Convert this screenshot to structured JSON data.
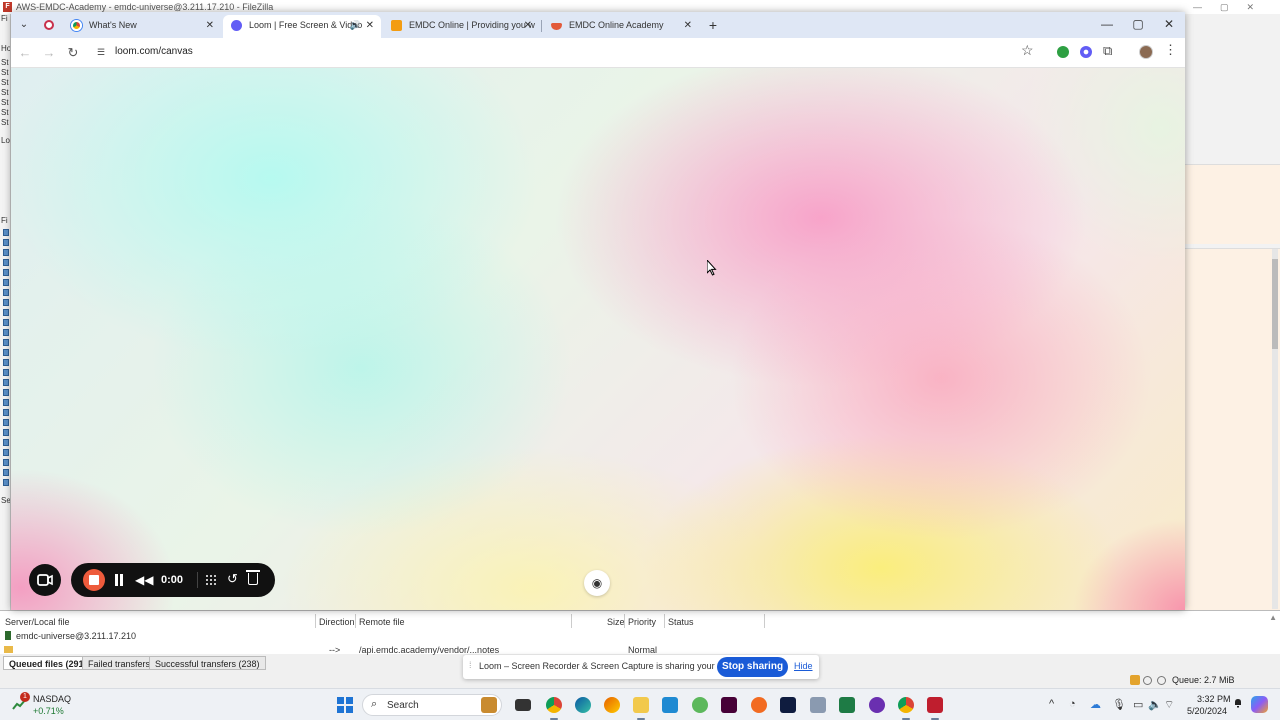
{
  "filezilla": {
    "title": "AWS-EMDC-Academy - emdc-universe@3.211.17.210 - FileZilla",
    "left_strip_lines": [
      "Fi",
      "Ho",
      "St",
      "St",
      "St",
      "St",
      "St",
      "St",
      "St",
      "Lo",
      "Fi",
      "Se"
    ],
    "queue": {
      "headers": {
        "server_local_file": "Server/Local file",
        "direction": "Direction",
        "remote_file": "Remote file",
        "size": "Size",
        "priority": "Priority",
        "status": "Status"
      },
      "server": "emdc-universe@3.211.17.210",
      "row": {
        "direction": "-->",
        "remote_file": "/api.emdc.academy/vendor/...notes",
        "priority": "Normal"
      }
    },
    "tabs": [
      "Queued files (291)",
      "Failed transfers",
      "Successful transfers (238)"
    ],
    "queue_size": "Queue: 2.7 MiB"
  },
  "browser": {
    "tabs": [
      {
        "title": "",
        "icon": "record-icon",
        "active": false
      },
      {
        "title": "What's New",
        "icon": "chrome-icon",
        "active": false
      },
      {
        "title": "Loom | Free Screen & Video",
        "icon": "loom-icon",
        "active": true
      },
      {
        "title": "EMDC Online | Providing you w",
        "icon": "emdc-icon",
        "active": false
      },
      {
        "title": "EMDC Online Academy",
        "icon": "emdc-academy-icon",
        "active": false
      }
    ],
    "url": "loom.com/canvas",
    "accent": "#dfe7f5"
  },
  "recorder": {
    "time": "0:00",
    "stop_color": "#ee5b3c"
  },
  "share_banner": {
    "text": "Loom – Screen Recorder & Screen Capture is sharing your screen.",
    "stop_label": "Stop sharing",
    "hide_label": "Hide",
    "accent": "#1a5bd7"
  },
  "taskbar": {
    "stock_badge": "1",
    "stock_name": "NASDAQ",
    "stock_change": "+0.71%",
    "search_placeholder": "Search",
    "time": "3:32 PM",
    "date": "5/20/2024"
  }
}
